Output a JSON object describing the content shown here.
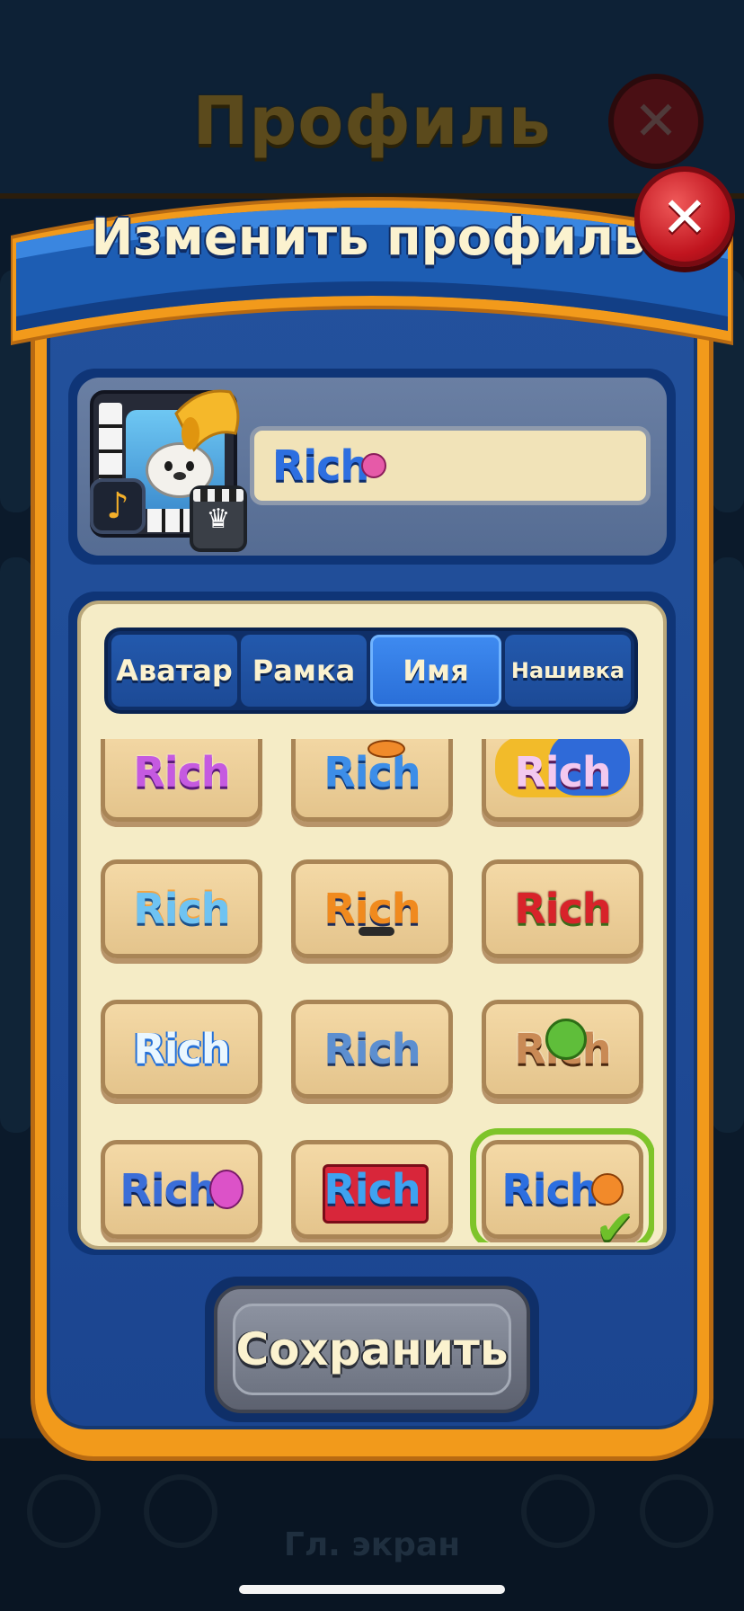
{
  "background": {
    "title": "Профиль",
    "close_symbol": "✕",
    "footer_label": "Гл. экран"
  },
  "dialog": {
    "title": "Изменить профиль",
    "close_symbol": "✕"
  },
  "profile": {
    "name_preview": "Rich",
    "note_symbol": "♪"
  },
  "tabs": [
    {
      "label": "Аватар",
      "active": false
    },
    {
      "label": "Рамка",
      "active": false
    },
    {
      "label": "Имя",
      "active": true
    },
    {
      "label": "Нашивка",
      "active": false
    }
  ],
  "nameplates": [
    {
      "text": "Rich",
      "style": "purple-sparkle"
    },
    {
      "text": "Rich",
      "style": "ufo-blue"
    },
    {
      "text": "Rich",
      "style": "pink-splash"
    },
    {
      "text": "Rich",
      "style": "sky-blue"
    },
    {
      "text": "Rich",
      "style": "orange-mustache"
    },
    {
      "text": "Rich",
      "style": "red-sequin"
    },
    {
      "text": "Rich",
      "style": "ice-blue"
    },
    {
      "text": "Rich",
      "style": "denim-blue"
    },
    {
      "text": "Rich",
      "style": "tree-brown"
    },
    {
      "text": "Rich",
      "style": "blue-pink-egg"
    },
    {
      "text": "Rich",
      "style": "red-curtain"
    },
    {
      "text": "Rich",
      "style": "blue-shell",
      "selected": true
    }
  ],
  "save_button": {
    "label": "Сохранить"
  },
  "check_symbol": "✔",
  "colors": {
    "dialog_orange": "#f29a1b",
    "dialog_blue": "#1b4590",
    "panel_cream": "#f5ecc6",
    "tab_active": "#3e8af0",
    "close_red": "#c0141e",
    "selected_green": "#7ec42a"
  }
}
